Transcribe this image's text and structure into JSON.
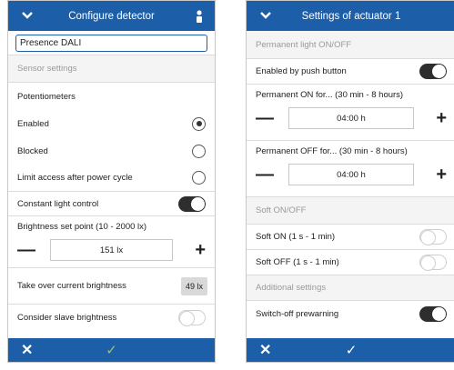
{
  "left": {
    "header_title": "Configure detector",
    "device_name": "Presence DALI",
    "sensor_settings": "Sensor settings",
    "potentiometers": "Potentiometers",
    "enabled": "Enabled",
    "blocked": "Blocked",
    "limit_access": "Limit access after power cycle",
    "constant_light": "Constant light control",
    "brightness_label": "Brightness set point (10 - 2000 lx)",
    "brightness_value": "151 lx",
    "take_over": "Take over current brightness",
    "current_brightness": "49 lx",
    "consider_slave": "Consider slave brightness"
  },
  "right": {
    "header_title": "Settings of actuator 1",
    "permanent_section": "Permanent light ON/OFF",
    "enabled_push": "Enabled by push button",
    "perm_on_label": "Permanent ON for... (30 min - 8 hours)",
    "perm_on_value": "04:00 h",
    "perm_off_label": "Permanent OFF for... (30 min - 8 hours)",
    "perm_off_value": "04:00 h",
    "soft_section": "Soft ON/OFF",
    "soft_on": "Soft ON (1 s - 1 min)",
    "soft_off": "Soft OFF (1 s - 1 min)",
    "additional_section": "Additional settings",
    "switch_off_prewarning": "Switch-off prewarning"
  },
  "glyphs": {
    "minus": "—",
    "plus": "+",
    "close": "✕",
    "check": "✓"
  },
  "colors": {
    "header_blue": "#1d5ea8",
    "confirm_disabled": "#9bc46a",
    "confirm_active": "#ffffff"
  }
}
